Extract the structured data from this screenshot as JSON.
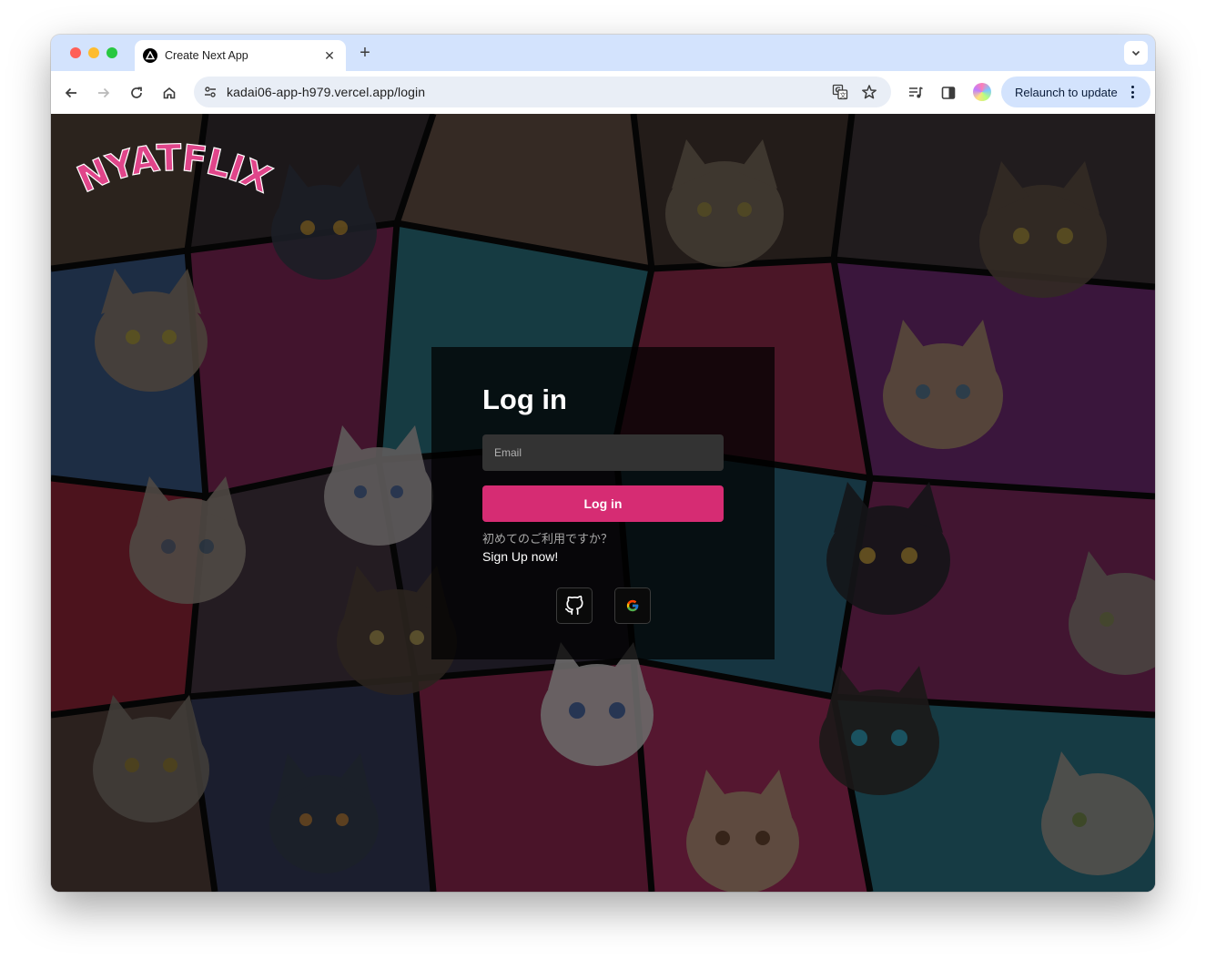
{
  "browser": {
    "tab_title": "Create Next App",
    "tab_close_glyph": "✕",
    "new_tab_glyph": "+",
    "url": "kadai06-app-h979.vercel.app/login",
    "relaunch_label": "Relaunch to update",
    "icons": [
      "back-arrow-icon",
      "forward-arrow-icon",
      "reload-icon",
      "home-icon",
      "site-settings-icon",
      "translate-icon",
      "bookmark-star-icon",
      "media-queue-icon",
      "side-panel-icon",
      "profile-avatar-icon",
      "more-vert-icon",
      "tab-search-chevron-icon"
    ]
  },
  "page": {
    "logo_text": "NYATFLIX",
    "login": {
      "title": "Log in",
      "email_placeholder": "Email",
      "submit_label": "Log in",
      "first_time_text": "初めてのご利用ですか？",
      "signup_label": "Sign Up now!",
      "oauth_providers": [
        "github-icon",
        "google-icon"
      ]
    }
  },
  "colors": {
    "accent": "#d62c73",
    "logo_pink": "#f0509a",
    "card_bg": "#000000",
    "input_bg": "#333333",
    "chrome_tab_strip": "#d3e3fd"
  }
}
